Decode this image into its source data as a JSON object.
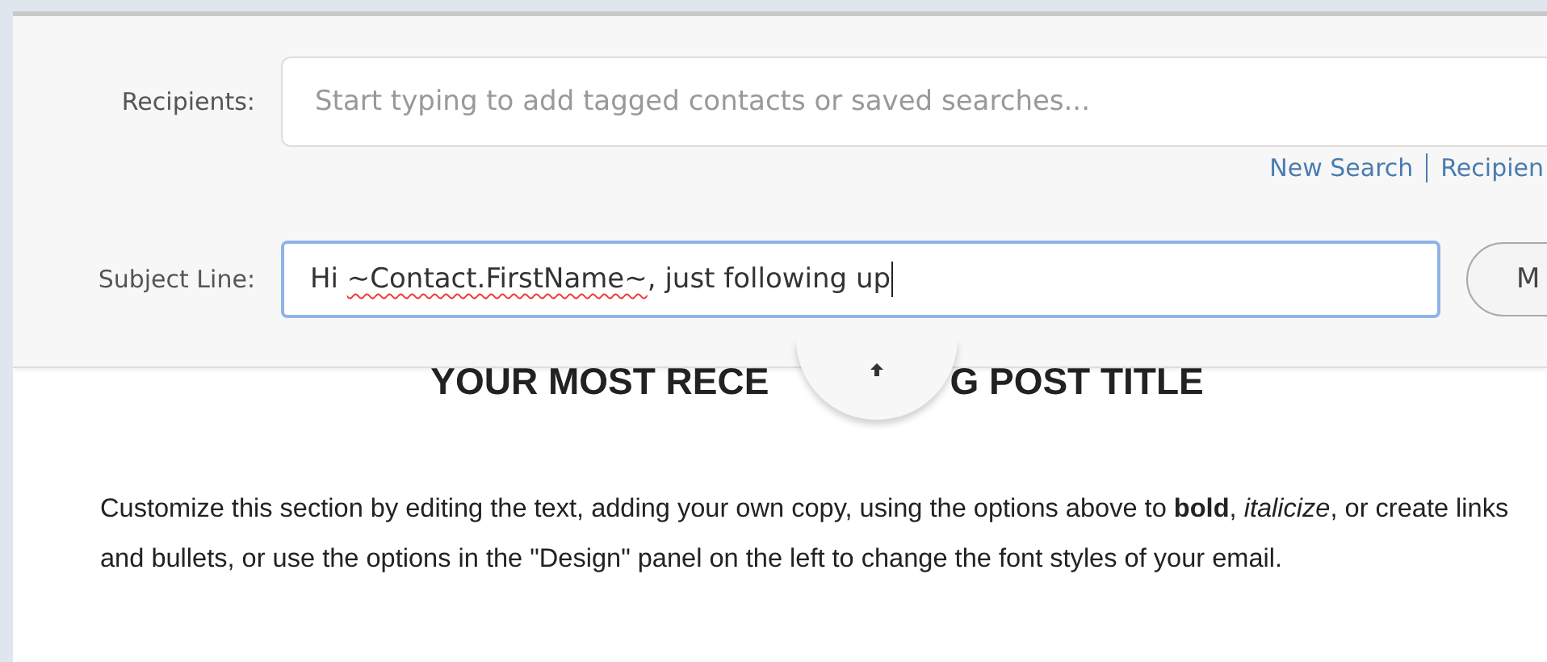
{
  "recipients": {
    "label": "Recipients:",
    "placeholder": "Start typing to add tagged contacts or saved searches..."
  },
  "links": [
    "New Search",
    "Recipien"
  ],
  "subject": {
    "label": "Subject Line:",
    "value_parts": [
      "Hi ",
      "~Contact.FirstName~",
      ", just following up"
    ],
    "button": "M"
  },
  "heading_parts": [
    "YOUR MOST RECE",
    "G POST TITLE"
  ],
  "body": "Customize this section by editing the text, adding your own copy, using the options above to **bold**, *italicize*, or create links and bullets, or use the options in the \"Design\" panel on the left to change the font styles of your email."
}
